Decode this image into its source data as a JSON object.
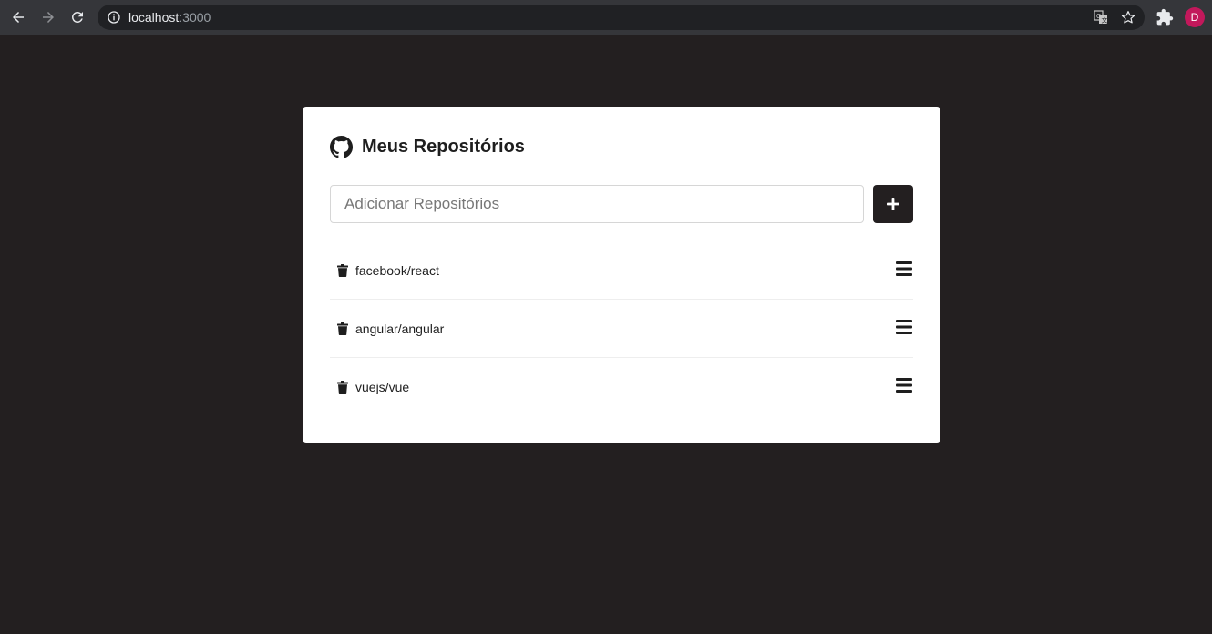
{
  "browser": {
    "url_host": "localhost",
    "url_port": ":3000",
    "profile_initial": "D",
    "icons": {
      "back": "arrow-left-icon",
      "forward": "arrow-right-icon",
      "reload": "reload-icon",
      "info": "info-icon",
      "translate": "translate-icon",
      "bookmark": "star-icon",
      "extensions": "puzzle-icon"
    }
  },
  "app": {
    "title": "Meus Repositórios",
    "logo_icon": "github-icon",
    "input_placeholder": "Adicionar Repositórios",
    "input_value": "",
    "add_button_icon": "plus-icon",
    "repositories": [
      {
        "name": "facebook/react",
        "delete_icon": "trash-icon",
        "details_icon": "bars-icon"
      },
      {
        "name": "angular/angular",
        "delete_icon": "trash-icon",
        "details_icon": "bars-icon"
      },
      {
        "name": "vuejs/vue",
        "delete_icon": "trash-icon",
        "details_icon": "bars-icon"
      }
    ]
  },
  "colors": {
    "page_background": "#231f20",
    "card_background": "#ffffff",
    "button_background": "#231f20",
    "avatar": "#c2185b"
  }
}
